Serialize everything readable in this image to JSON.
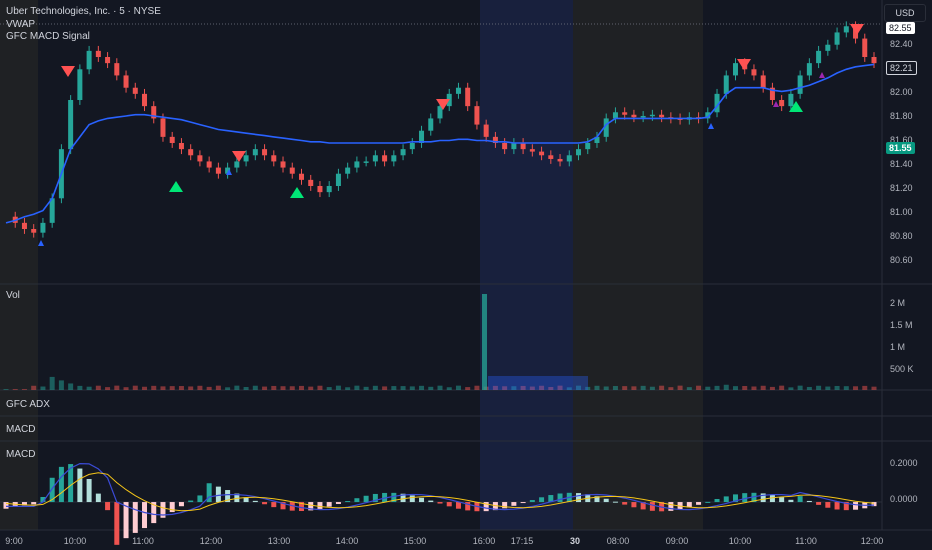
{
  "header": {
    "symbol_title": "Uber Technologies, Inc. · 5 · NYSE",
    "indicator_1": "VWAP",
    "indicator_2": "GFC MACD Signal"
  },
  "currency_button": "USD",
  "price_axis": {
    "ticks": [
      "82.40",
      "82.00",
      "81.80",
      "81.60",
      "81.40",
      "81.20",
      "81.00",
      "80.80",
      "80.60"
    ],
    "high_tag": "82.55",
    "last_price_tag": "82.21",
    "vwap_tag": "81.55"
  },
  "volume_pane": {
    "title": "Vol",
    "ticks": [
      "2 M",
      "1.5 M",
      "1 M",
      "500 K"
    ]
  },
  "adx_pane": {
    "title": "GFC ADX"
  },
  "macd_pane_1": {
    "title": "MACD"
  },
  "macd_pane_2": {
    "title": "MACD",
    "ticks": [
      "0.2000",
      "0.0000"
    ]
  },
  "time_axis": [
    "9:00",
    "10:00",
    "11:00",
    "12:00",
    "13:00",
    "14:00",
    "15:00",
    "16:00",
    "17:15",
    "30",
    "08:00",
    "09:00",
    "10:00",
    "11:00",
    "12:00"
  ],
  "colors": {
    "background": "#131722",
    "up": "#26a69a",
    "down": "#ef5350",
    "vwap": "#2962ff",
    "signal_up": "#00e676",
    "signal_down": "#ff5252",
    "session_pre": "#2a2a26",
    "session_post": "#1a2140",
    "macd_line": "#3b4bd6",
    "signal_line": "#f5c518"
  },
  "chart_data": {
    "type": "candlestick",
    "ylim": [
      80.5,
      82.6
    ],
    "price_path": [
      80.95,
      80.9,
      80.85,
      80.82,
      80.9,
      81.1,
      81.5,
      81.9,
      82.15,
      82.3,
      82.25,
      82.2,
      82.1,
      82.0,
      81.95,
      81.85,
      81.75,
      81.6,
      81.55,
      81.5,
      81.45,
      81.4,
      81.35,
      81.3,
      81.35,
      81.4,
      81.45,
      81.5,
      81.45,
      81.4,
      81.35,
      81.3,
      81.25,
      81.2,
      81.15,
      81.2,
      81.3,
      81.35,
      81.4,
      81.4,
      81.45,
      81.4,
      81.45,
      81.5,
      81.55,
      81.65,
      81.75,
      81.85,
      81.95,
      82.0,
      81.85,
      81.7,
      81.6,
      81.55,
      81.5,
      81.55,
      81.5,
      81.48,
      81.45,
      81.42,
      81.4,
      81.45,
      81.5,
      81.55,
      81.6,
      81.75,
      81.8,
      81.78,
      81.76,
      81.77,
      81.78,
      81.76,
      81.75,
      81.74,
      81.76,
      81.75,
      81.8,
      81.95,
      82.1,
      82.2,
      82.15,
      82.1,
      82.0,
      81.9,
      81.85,
      81.95,
      82.1,
      82.2,
      82.3,
      82.35,
      82.45,
      82.5,
      82.4,
      82.25,
      82.2
    ],
    "vwap": [
      80.9,
      80.92,
      80.95,
      80.97,
      81.0,
      81.1,
      81.3,
      81.5,
      81.6,
      81.7,
      81.73,
      81.75,
      81.76,
      81.77,
      81.78,
      81.78,
      81.77,
      81.76,
      81.75,
      81.74,
      81.72,
      81.7,
      81.68,
      81.66,
      81.65,
      81.64,
      81.63,
      81.62,
      81.61,
      81.6,
      81.59,
      81.58,
      81.57,
      81.56,
      81.56,
      81.55,
      81.55,
      81.55,
      81.55,
      81.55,
      81.55,
      81.55,
      81.55,
      81.55,
      81.56,
      81.56,
      81.56,
      81.57,
      81.57,
      81.58,
      81.58,
      81.57,
      81.57,
      81.56,
      81.56,
      81.55,
      81.55,
      81.55,
      81.55,
      81.55,
      81.55,
      81.55,
      81.55,
      81.56,
      81.6,
      81.7,
      81.75,
      81.75,
      81.75,
      81.75,
      81.75,
      81.75,
      81.75,
      81.75,
      81.75,
      81.75,
      81.76,
      81.85,
      81.95,
      82.0,
      82.0,
      82.0,
      82.0,
      81.98,
      81.97,
      81.98,
      82.0,
      82.02,
      82.05,
      82.08,
      82.12,
      82.15,
      82.17,
      82.18,
      82.19
    ],
    "volume_spike_value_m": 2.2,
    "macd_ylim": [
      -0.12,
      0.25
    ]
  }
}
